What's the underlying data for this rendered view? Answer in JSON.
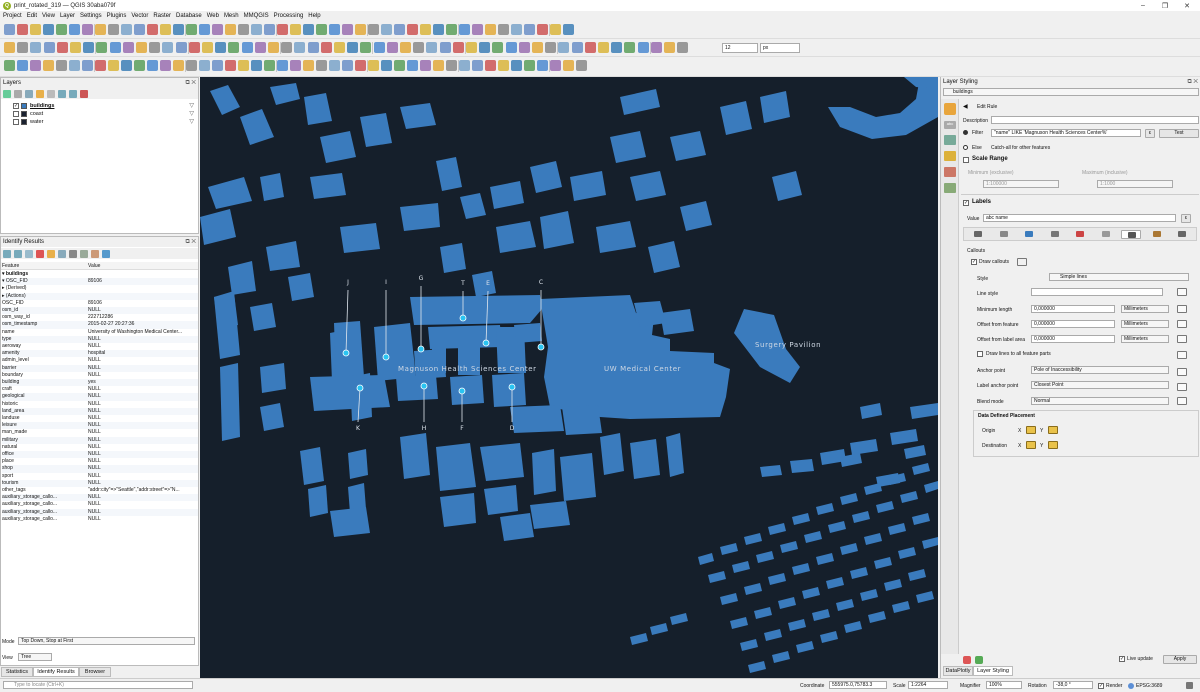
{
  "window": {
    "title": "print_rotated_319 — QGIS 30aba079f",
    "min": "–",
    "max": "❐",
    "close": "✕"
  },
  "menu": [
    "Project",
    "Edit",
    "View",
    "Layer",
    "Settings",
    "Plugins",
    "Vector",
    "Raster",
    "Database",
    "Web",
    "Mesh",
    "MMQGIS",
    "Processing",
    "Help"
  ],
  "toolbar": {
    "font_size": "12",
    "font_unit": "px"
  },
  "layers_panel": {
    "title": "Layers",
    "items": [
      {
        "name": "buildings",
        "checked": true,
        "color": "#3a7bbd"
      },
      {
        "name": "coast",
        "checked": false,
        "color": "#1a2230"
      },
      {
        "name": "water",
        "checked": false,
        "color": "#1a2230"
      }
    ]
  },
  "identify": {
    "title": "Identify Results",
    "col_feature": "Feature",
    "col_value": "Value",
    "rows": [
      [
        "▾ buildings",
        ""
      ],
      [
        "  ▾ OSC_FID",
        "89106"
      ],
      [
        "    ▸ (Derived)",
        ""
      ],
      [
        "    ▸ (Actions)",
        ""
      ],
      [
        "    OSC_FID",
        "89106"
      ],
      [
        "    osm_id",
        "NULL"
      ],
      [
        "    osm_way_id",
        "222712286"
      ],
      [
        "    osm_timestamp",
        "2015-02-27 20:27:36"
      ],
      [
        "    name",
        "University of Washington Medical Center..."
      ],
      [
        "    type",
        "NULL"
      ],
      [
        "    aeroway",
        "NULL"
      ],
      [
        "    amenity",
        "hospital"
      ],
      [
        "    admin_level",
        "NULL"
      ],
      [
        "    barrier",
        "NULL"
      ],
      [
        "    boundary",
        "NULL"
      ],
      [
        "    building",
        "yes"
      ],
      [
        "    craft",
        "NULL"
      ],
      [
        "    geological",
        "NULL"
      ],
      [
        "    historic",
        "NULL"
      ],
      [
        "    land_area",
        "NULL"
      ],
      [
        "    landuse",
        "NULL"
      ],
      [
        "    leisure",
        "NULL"
      ],
      [
        "    man_made",
        "NULL"
      ],
      [
        "    military",
        "NULL"
      ],
      [
        "    natural",
        "NULL"
      ],
      [
        "    office",
        "NULL"
      ],
      [
        "    place",
        "NULL"
      ],
      [
        "    shop",
        "NULL"
      ],
      [
        "    sport",
        "NULL"
      ],
      [
        "    tourism",
        "NULL"
      ],
      [
        "    other_tags",
        "\"addr:city\"=>\"Seattle\",\"addr:street\"=>\"N..."
      ],
      [
        "    auxiliary_storage_callo...",
        "NULL"
      ],
      [
        "    auxiliary_storage_callo...",
        "NULL"
      ],
      [
        "    auxiliary_storage_callo...",
        "NULL"
      ],
      [
        "    auxiliary_storage_callo...",
        "NULL"
      ]
    ],
    "mode_label": "Mode",
    "mode_value": "Top Down, Stop at First",
    "view_label": "View",
    "view_value": "Tree"
  },
  "bottom_tabs": [
    "Statistics",
    "Identify Results",
    "Browser"
  ],
  "locator_placeholder": "Type to locate (Ctrl+K)",
  "map": {
    "labels": [
      "Magnuson Health Sciences Center",
      "UW Medical Center",
      "Surgery Pavilion"
    ],
    "callouts_top": [
      "J",
      "I",
      "G",
      "T",
      "E",
      "C"
    ],
    "callouts_bottom": [
      "K",
      "H",
      "F",
      "D"
    ]
  },
  "styling": {
    "title": "Layer Styling",
    "layer": "buildings",
    "edit_rule": "Edit Rule",
    "description_label": "Description",
    "filter_label": "Filter",
    "filter_value": "\"name\" LIKE 'Magnuson Health Sciences Center%'",
    "test_button": "Test",
    "else_label": "Else",
    "else_text": "Catch-all for other features",
    "scale_range": "Scale Range",
    "min_label": "Minimum (exclusive)",
    "max_label": "Maximum (inclusive)",
    "min_value": "1:100000",
    "max_value": "1:1000",
    "labels_section": "Labels",
    "value_label": "Value",
    "value_field": "abc name",
    "callouts_label": "Callouts",
    "draw_callouts": "Draw callouts",
    "style_label": "Style",
    "style_value": "Simple lines",
    "line_style_label": "Line style",
    "min_length_label": "Minimum length",
    "min_length": "0,000000",
    "offset_feature_label": "Offset from feature",
    "offset_feature": "0,000000",
    "offset_label_label": "Offset from label area",
    "offset_label": "0,000000",
    "unit": "Millimeters",
    "draw_all_parts": "Draw lines to all feature parts",
    "anchor_label": "Anchor point",
    "anchor_value": "Pole of Inaccessibility",
    "label_anchor_label": "Label anchor point",
    "label_anchor_value": "Closest Point",
    "blend_label": "Blend mode",
    "blend_value": "Normal",
    "ddp_title": "Data Defined Placement",
    "origin_label": "Origin",
    "destination_label": "Destination",
    "x": "X",
    "y": "Y",
    "live_update": "Live update",
    "apply": "Apply",
    "tab_dataplotly": "DataPlotly",
    "tab_styling": "Layer Styling"
  },
  "status": {
    "coordinate_label": "Coordinate",
    "coordinate": "555975.0,75783.3",
    "scale_label": "Scale",
    "scale": "1:2264",
    "magnifier_label": "Magnifier",
    "magnifier": "100%",
    "rotation_label": "Rotation",
    "rotation": "-38,0 °",
    "render": "Render",
    "crs": "EPSG:3689"
  },
  "colors": {
    "building": "#3a7bbd",
    "map_bg": "#151f2b",
    "callout_dot": "#29c4f2"
  }
}
